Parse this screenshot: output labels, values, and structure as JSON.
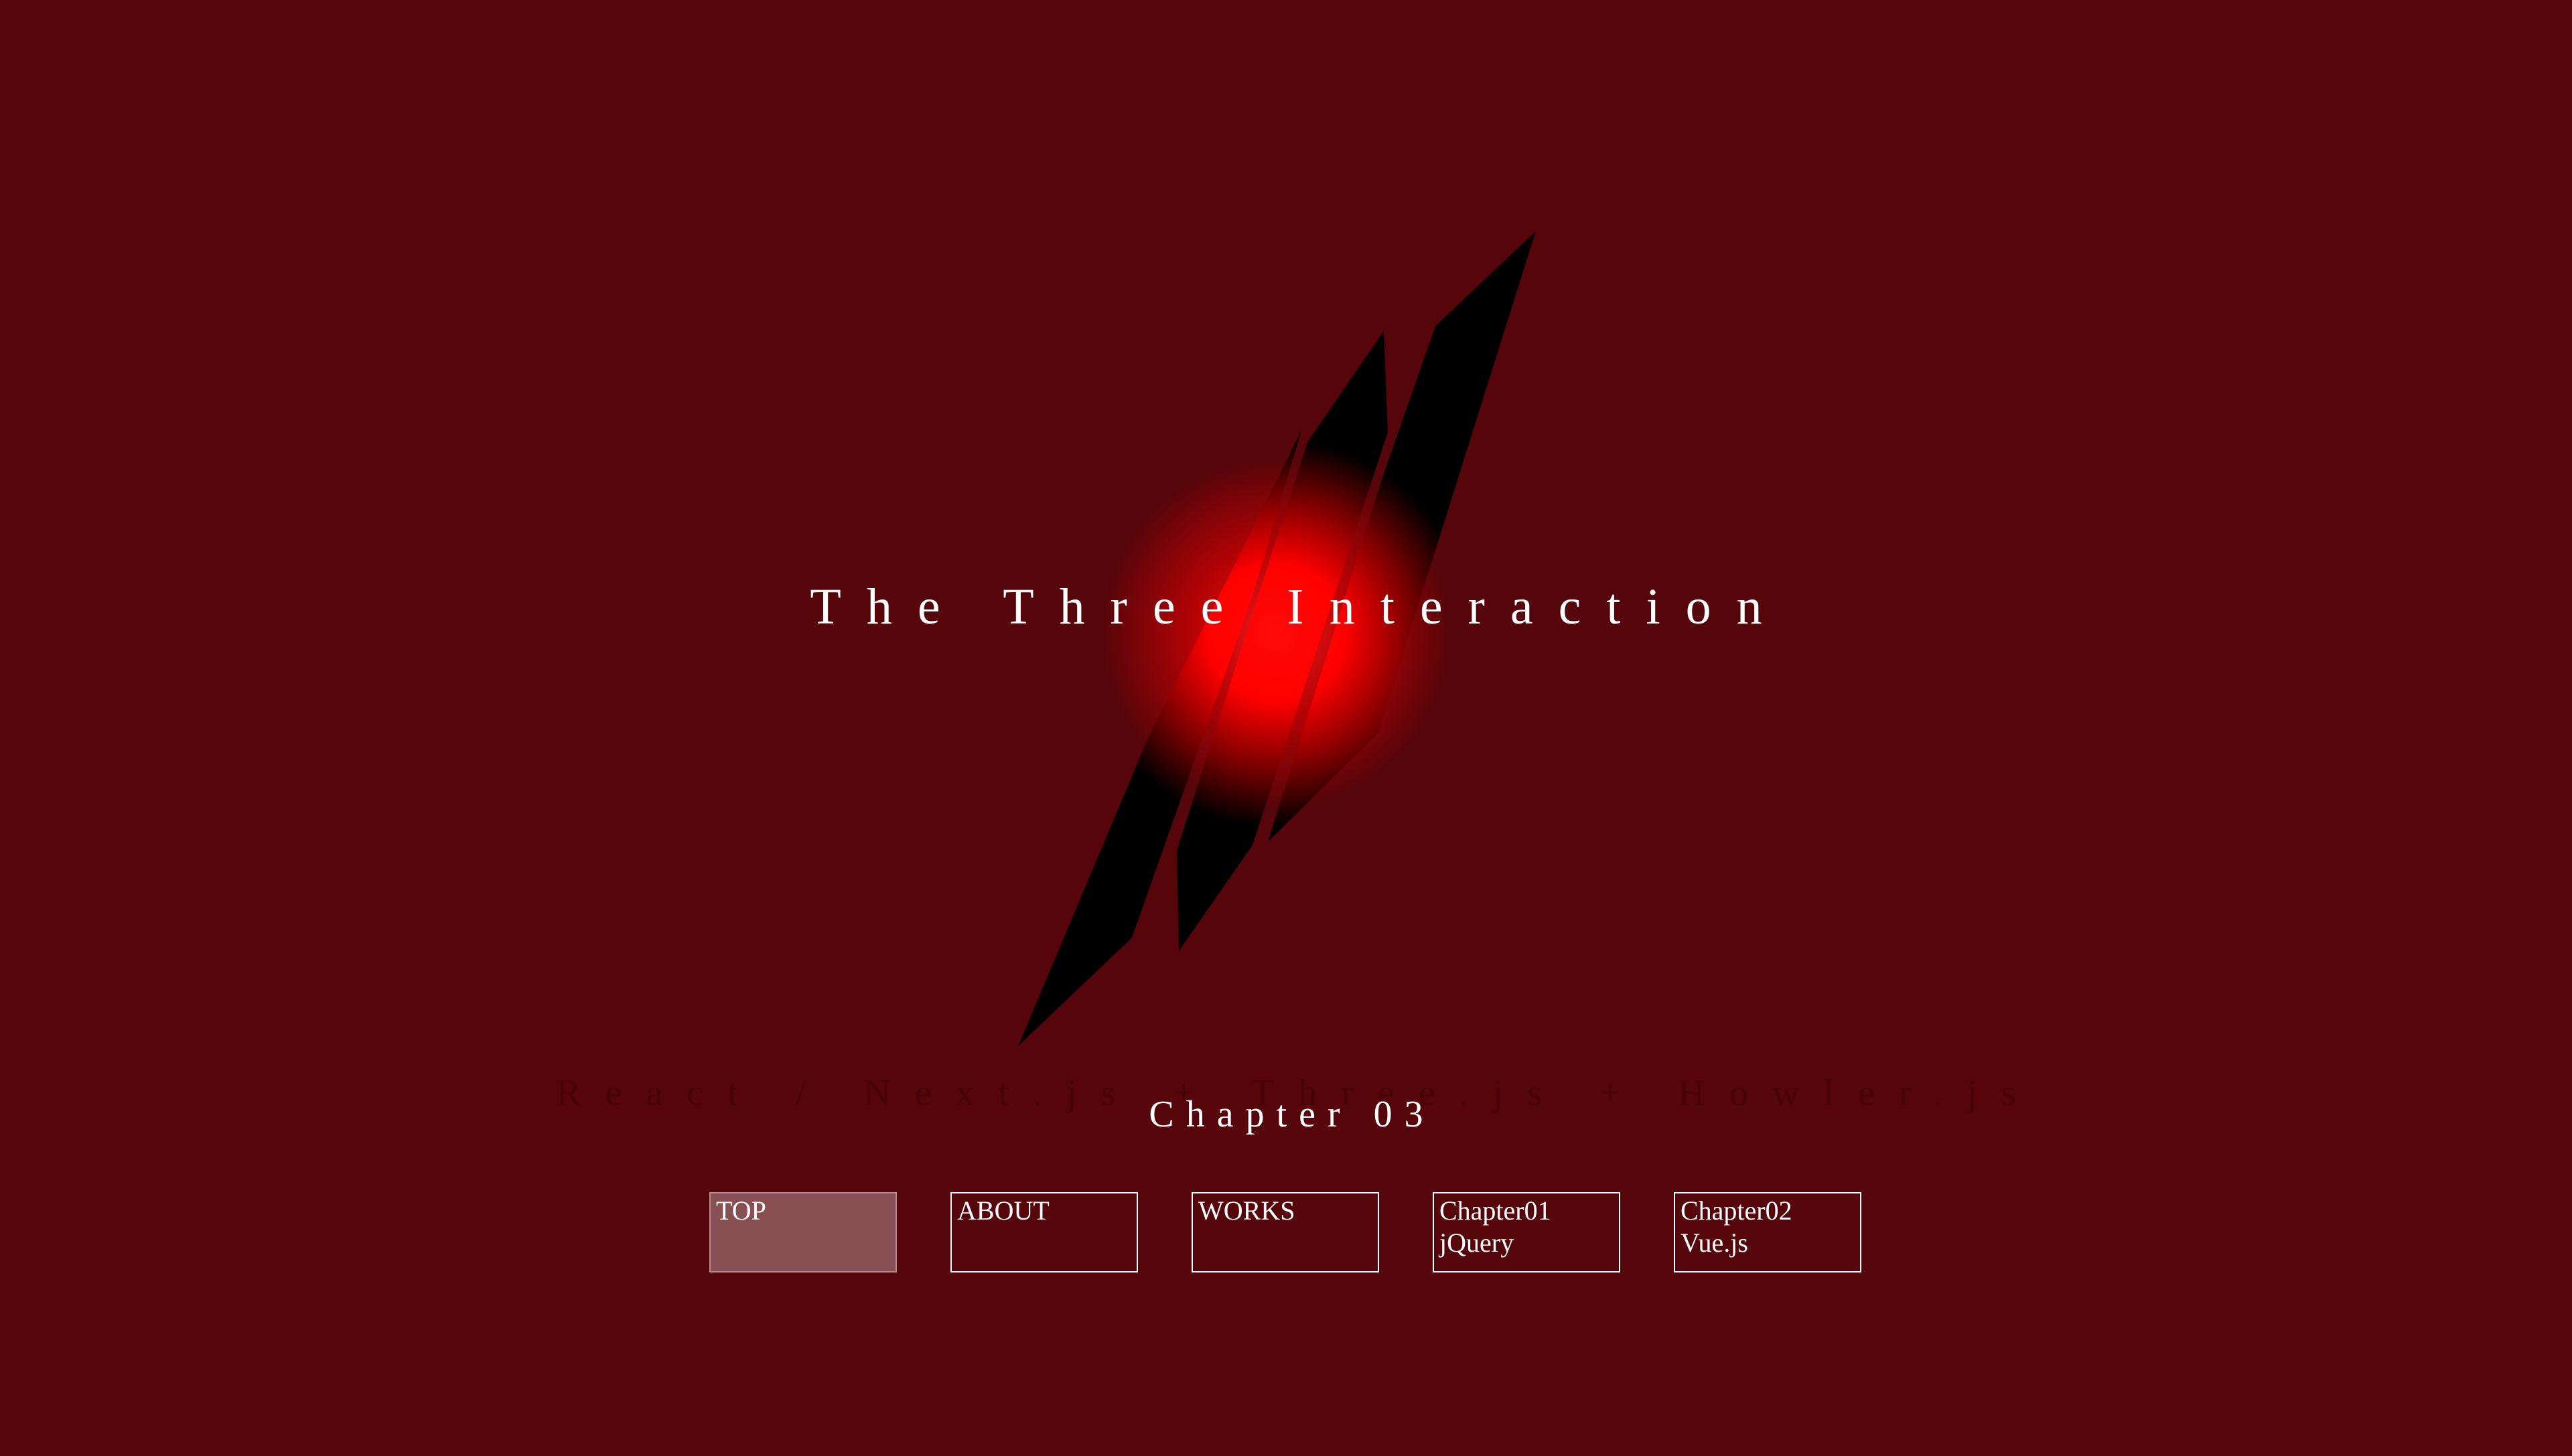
{
  "hero": {
    "title": "The Three Interaction",
    "subtitle": "React / Next.js + Three.js + Howler.js",
    "chapter": "Chapter 03"
  },
  "nav": {
    "items": [
      {
        "line1": "TOP",
        "line2": "",
        "active": true
      },
      {
        "line1": "ABOUT",
        "line2": "",
        "active": false
      },
      {
        "line1": "WORKS",
        "line2": "",
        "active": false
      },
      {
        "line1": "Chapter01",
        "line2": "jQuery",
        "active": false
      },
      {
        "line1": "Chapter02",
        "line2": "Vue.js",
        "active": false
      }
    ]
  },
  "colors": {
    "background": "#56050a",
    "glow": "#ff0000",
    "blade": "#000000",
    "text": "#ffffff"
  },
  "icons": {
    "emblem": "claw-slash-emblem"
  }
}
